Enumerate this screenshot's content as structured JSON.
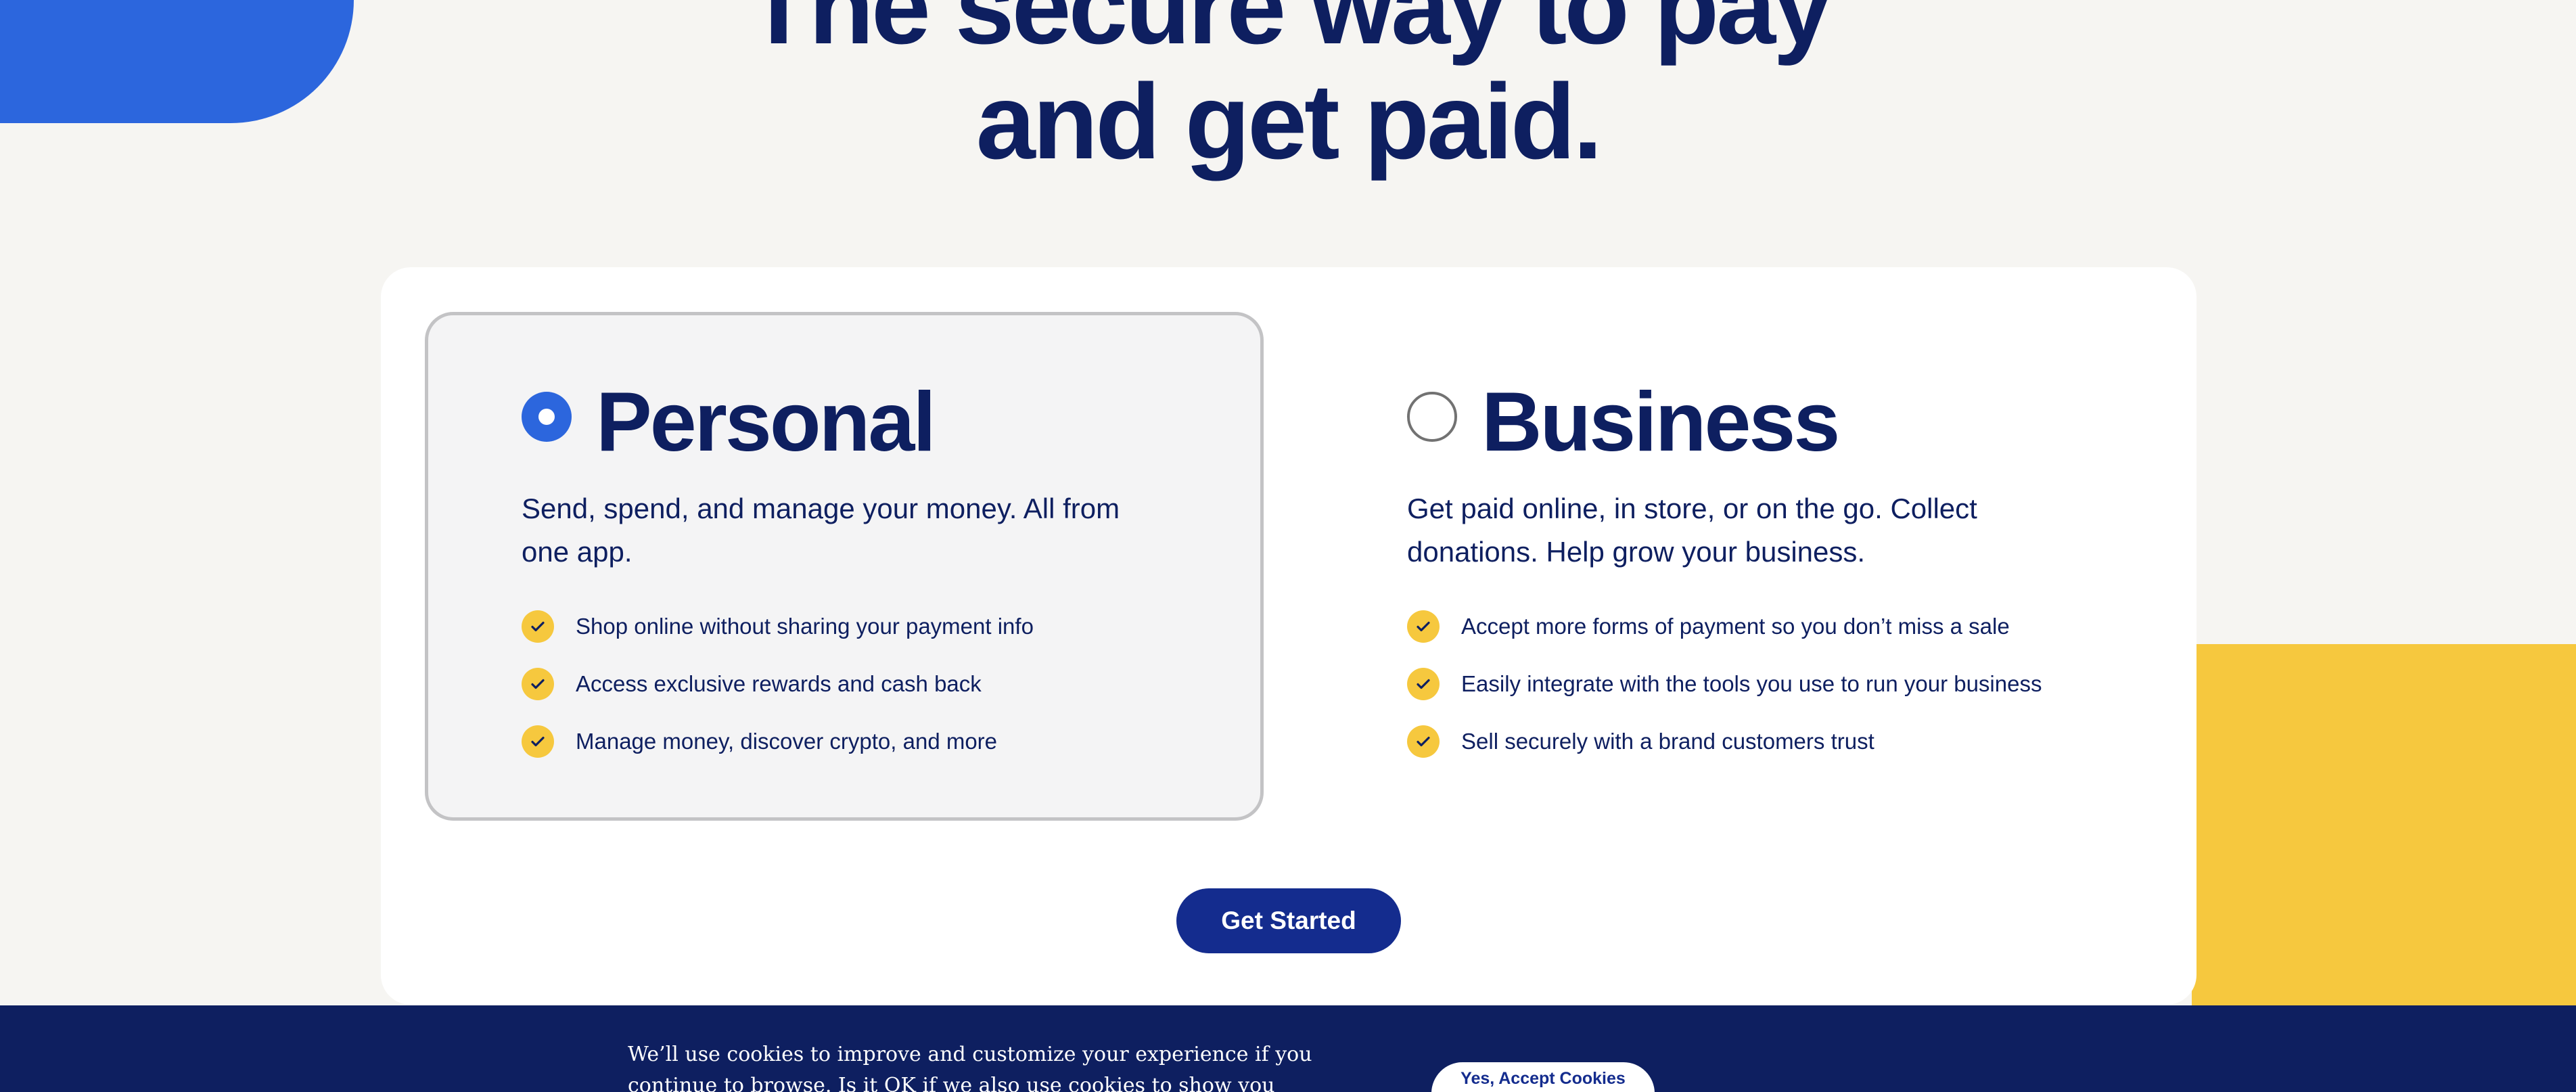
{
  "hero": {
    "headline_line1": "The secure way to pay",
    "headline_line2": "and get paid."
  },
  "account_types": {
    "selected": "personal",
    "personal": {
      "title": "Personal",
      "description": "Send, spend, and manage your money. All from one app.",
      "features": [
        "Shop online without sharing your payment info",
        "Access exclusive rewards and cash back",
        "Manage money, discover crypto, and more"
      ]
    },
    "business": {
      "title": "Business",
      "description": "Get paid online, in store, or on the go. Collect donations. Help grow your business.",
      "features": [
        "Accept more forms of payment so you don’t miss a sale",
        "Easily integrate with the tools you use to run your business",
        "Sell securely with a brand customers trust"
      ]
    },
    "cta_label": "Get Started"
  },
  "cookie_banner": {
    "text": "We’ll use cookies to improve and customize your experience if you continue to browse. Is it OK if we also use cookies to show you personalized ads?",
    "accept_label": "Yes, Accept Cookies"
  },
  "colors": {
    "navy": "#0e1f60",
    "brand_blue": "#2c66dd",
    "button_blue": "#142c8e",
    "accent_yellow": "#f6c83e",
    "page_background": "#f6f5f2"
  },
  "icons": {
    "feature_check": "check-icon",
    "radio_selected": "radio-selected-icon",
    "radio_unselected": "radio-unselected-icon"
  }
}
